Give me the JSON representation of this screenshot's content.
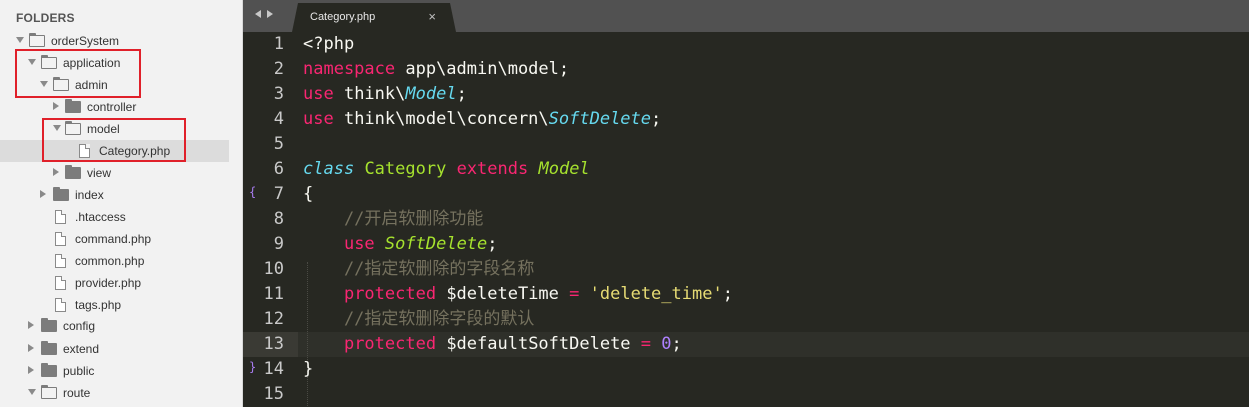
{
  "sidebar": {
    "header": "FOLDERS",
    "items": [
      {
        "label": "orderSystem",
        "kind": "folder-open",
        "arrow": "down"
      },
      {
        "label": "application",
        "kind": "folder-open",
        "arrow": "down"
      },
      {
        "label": "admin",
        "kind": "folder-open",
        "arrow": "down"
      },
      {
        "label": "controller",
        "kind": "folder",
        "arrow": "right"
      },
      {
        "label": "model",
        "kind": "folder-open",
        "arrow": "down"
      },
      {
        "label": "Category.php",
        "kind": "file",
        "arrow": "none",
        "selected": true
      },
      {
        "label": "view",
        "kind": "folder",
        "arrow": "right"
      },
      {
        "label": "index",
        "kind": "folder",
        "arrow": "right"
      },
      {
        "label": ".htaccess",
        "kind": "file",
        "arrow": "none"
      },
      {
        "label": "command.php",
        "kind": "file",
        "arrow": "none"
      },
      {
        "label": "common.php",
        "kind": "file",
        "arrow": "none"
      },
      {
        "label": "provider.php",
        "kind": "file",
        "arrow": "none"
      },
      {
        "label": "tags.php",
        "kind": "file",
        "arrow": "none"
      },
      {
        "label": "config",
        "kind": "folder",
        "arrow": "right"
      },
      {
        "label": "extend",
        "kind": "folder",
        "arrow": "right"
      },
      {
        "label": "public",
        "kind": "folder",
        "arrow": "right"
      },
      {
        "label": "route",
        "kind": "folder-open",
        "arrow": "down"
      }
    ]
  },
  "editor": {
    "tab_title": "Category.php",
    "tab_close": "×",
    "line_numbers": [
      "1",
      "2",
      "3",
      "4",
      "5",
      "6",
      "7",
      "8",
      "9",
      "10",
      "11",
      "12",
      "13",
      "14",
      "15"
    ],
    "fold_open": "{",
    "fold_close": "}",
    "lines": [
      [
        {
          "t": "<?php",
          "c": "var"
        }
      ],
      [
        {
          "t": "namespace",
          "c": "kw"
        },
        {
          "t": " app\\admin\\model;",
          "c": "var"
        }
      ],
      [
        {
          "t": "use",
          "c": "kw"
        },
        {
          "t": " think\\",
          "c": "var"
        },
        {
          "t": "Model",
          "c": "st"
        },
        {
          "t": ";",
          "c": "var"
        }
      ],
      [
        {
          "t": "use",
          "c": "kw"
        },
        {
          "t": " think\\model\\concern\\",
          "c": "var"
        },
        {
          "t": "SoftDelete",
          "c": "st"
        },
        {
          "t": ";",
          "c": "var"
        }
      ],
      [],
      [
        {
          "t": "class",
          "c": "st"
        },
        {
          "t": " ",
          "c": "var"
        },
        {
          "t": "Category",
          "c": "cls"
        },
        {
          "t": " ",
          "c": "var"
        },
        {
          "t": "extends",
          "c": "kw"
        },
        {
          "t": " ",
          "c": "var"
        },
        {
          "t": "Model",
          "c": "clsi"
        }
      ],
      [
        {
          "t": "{",
          "c": "var"
        }
      ],
      [
        {
          "t": "    //开启软删除功能",
          "c": "cm"
        }
      ],
      [
        {
          "t": "    ",
          "c": "var"
        },
        {
          "t": "use",
          "c": "kw"
        },
        {
          "t": " ",
          "c": "var"
        },
        {
          "t": "SoftDelete",
          "c": "clsi"
        },
        {
          "t": ";",
          "c": "var"
        }
      ],
      [
        {
          "t": "    //指定软删除的字段名称",
          "c": "cm"
        }
      ],
      [
        {
          "t": "    ",
          "c": "var"
        },
        {
          "t": "protected",
          "c": "kw"
        },
        {
          "t": " $deleteTime ",
          "c": "var"
        },
        {
          "t": "=",
          "c": "kw"
        },
        {
          "t": " ",
          "c": "var"
        },
        {
          "t": "'delete_time'",
          "c": "str"
        },
        {
          "t": ";",
          "c": "var"
        }
      ],
      [
        {
          "t": "    //指定软删除字段的默认",
          "c": "cm"
        }
      ],
      [
        {
          "t": "    ",
          "c": "var"
        },
        {
          "t": "protected",
          "c": "kw"
        },
        {
          "t": " $defaultSoftDelete ",
          "c": "var"
        },
        {
          "t": "=",
          "c": "kw"
        },
        {
          "t": " ",
          "c": "var"
        },
        {
          "t": "0",
          "c": "num"
        },
        {
          "t": ";",
          "c": "var"
        }
      ],
      [
        {
          "t": "}",
          "c": "var"
        }
      ],
      []
    ]
  },
  "colors": {
    "keyword": "#f92672",
    "storage_italic": "#66d9ef",
    "class_name": "#a6e22e",
    "string": "#e6db74",
    "number": "#ae81ff",
    "comment": "#75715e",
    "highlight_box": "#e0202a"
  }
}
